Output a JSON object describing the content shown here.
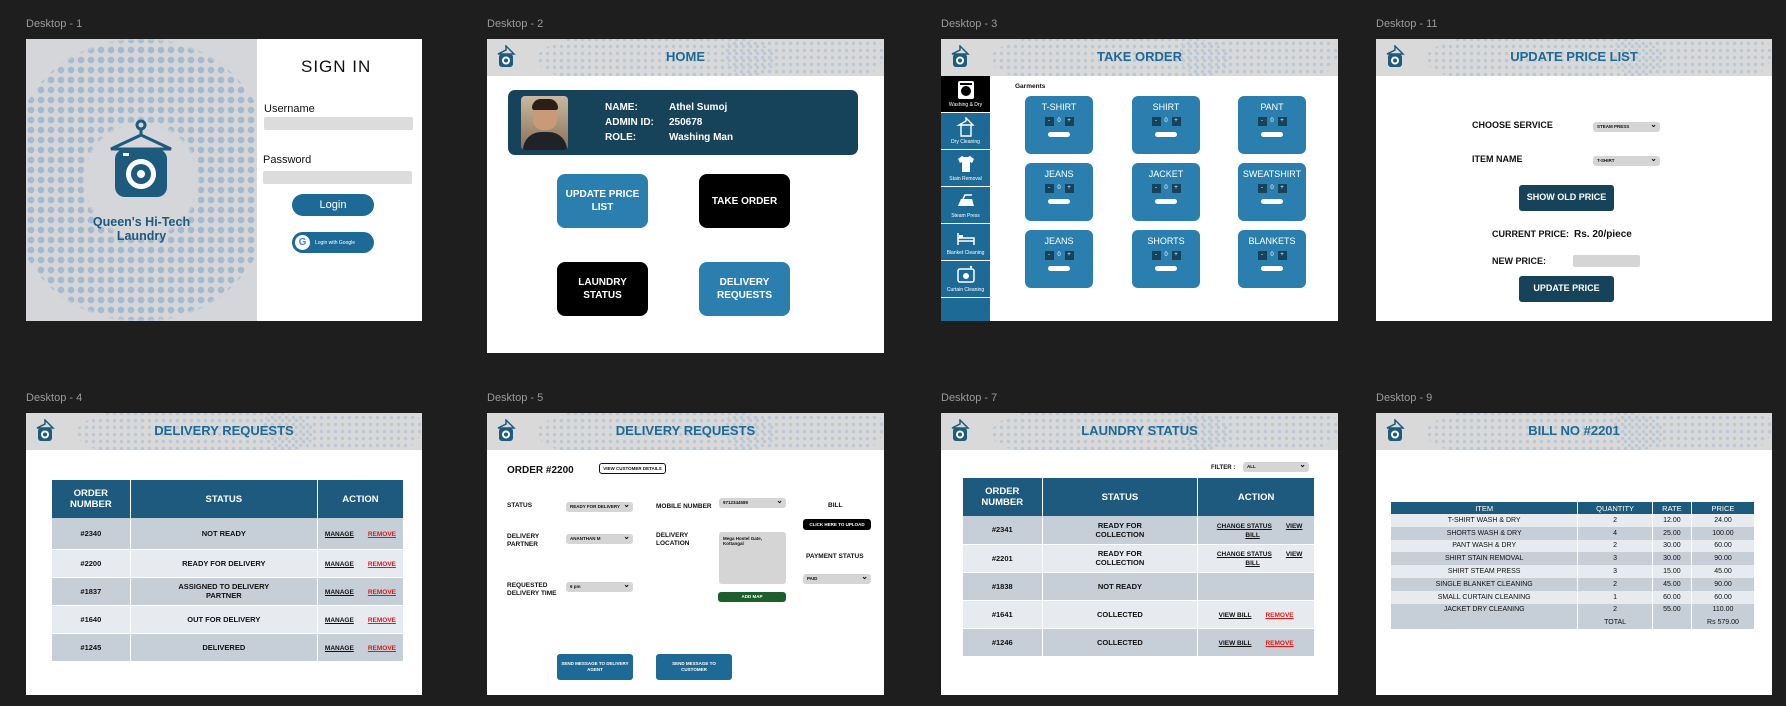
{
  "frames": {
    "d1": "Desktop - 1",
    "d2": "Desktop - 2",
    "d3": "Desktop - 3",
    "d11": "Desktop - 11",
    "d4": "Desktop - 4",
    "d5": "Desktop - 5",
    "d7": "Desktop - 7",
    "d9": "Desktop - 9"
  },
  "signin": {
    "brand": "Queen's Hi-Tech Laundry",
    "title": "SIGN IN",
    "username_label": "Username",
    "password_label": "Password",
    "login": "Login",
    "google": "Login with Google"
  },
  "home": {
    "title": "HOME",
    "name_label": "NAME:",
    "name": "Athel Sumoj",
    "id_label": "ADMIN ID:",
    "id": "250678",
    "role_label": "ROLE:",
    "role": "Washing Man",
    "btn_update": "UPDATE PRICE LIST",
    "btn_take": "TAKE ORDER",
    "btn_status": "LAUNDRY STATUS",
    "btn_delivery": "DELIVERY REQUESTS"
  },
  "take_order": {
    "title": "TAKE ORDER",
    "section": "Garments",
    "sidebar": [
      "Washing & Dry",
      "Dry Cleaning",
      "Stain Removal",
      "Steam Press",
      "Blanket Cleaning",
      "Curtain Cleaning"
    ],
    "garments": [
      "T-SHIRT",
      "SHIRT",
      "PANT",
      "JEANS",
      "JACKET",
      "SWEATSHIRT",
      "JEANS",
      "SHORTS",
      "BLANKETS"
    ],
    "qty": "0"
  },
  "update_price": {
    "title": "UPDATE PRICE LIST",
    "service_label": "CHOOSE SERVICE",
    "service_value": "STEAM PRESS",
    "item_label": "ITEM NAME",
    "item_value": "T-SHIRT",
    "show_old": "SHOW OLD PRICE",
    "current_label": "CURRENT PRICE:",
    "current_value": "Rs. 20/piece",
    "new_label": "NEW PRICE:",
    "update_btn": "UPDATE PRICE"
  },
  "delivery_requests": {
    "title": "DELIVERY REQUESTS",
    "headers": [
      "ORDER NUMBER",
      "STATUS",
      "ACTION"
    ],
    "manage": "MANAGE",
    "remove": "REMOVE",
    "rows": [
      {
        "order": "#2340",
        "status": "NOT READY"
      },
      {
        "order": "#2200",
        "status": "READY FOR DELIVERY"
      },
      {
        "order": "#1837",
        "status": "ASSIGNED TO DELIVERY PARTNER"
      },
      {
        "order": "#1640",
        "status": "OUT FOR DELIVERY"
      },
      {
        "order": "#1245",
        "status": "DELIVERED"
      }
    ]
  },
  "order_detail": {
    "title": "DELIVERY REQUESTS",
    "order": "ORDER #2200",
    "view_customer": "VIEW CUSTOMER DETAILS",
    "status_label": "STATUS",
    "status_value": "READY FOR DELIVERY",
    "partner_label": "DELIVERY PARTNER",
    "partner_value": "ANANTHAN M",
    "time_label": "REQUESTED DELIVERY TIME",
    "time_value": "6 pm",
    "mobile_label": "MOBILE NUMBER",
    "mobile_value": "9712344589",
    "location_label": "DELIVERY LOCATION",
    "location_value": "Mega Hostel Gate, Kottangal",
    "add_map": "ADD MAP",
    "bill_label": "BILL",
    "upload": "CLICK HERE TO UPLOAD",
    "payment_label": "PAYMENT STATUS",
    "payment_value": "PAID",
    "msg_agent": "SEND MESSAGE TO DELIVERY AGENT",
    "msg_customer": "SEND MESSAGE TO CUSTOMER"
  },
  "laundry_status": {
    "title": "LAUNDRY STATUS",
    "filter_label": "FILTER :",
    "filter_value": "ALL",
    "headers": [
      "ORDER NUMBER",
      "STATUS",
      "ACTION"
    ],
    "change": "CHANGE STATUS",
    "view": "VIEW BILL",
    "remove": "REMOVE",
    "rows": [
      {
        "order": "#2341",
        "status": "READY FOR COLLECTION"
      },
      {
        "order": "#2201",
        "status": "READY FOR COLLECTION"
      },
      {
        "order": "#1838",
        "status": "NOT READY"
      },
      {
        "order": "#1641",
        "status": "COLLECTED"
      },
      {
        "order": "#1246",
        "status": "COLLECTED"
      }
    ]
  },
  "bill": {
    "title": "BILL NO #2201",
    "headers": [
      "ITEM",
      "QUANTITY",
      "RATE",
      "PRICE"
    ],
    "rows": [
      [
        "T-SHIRT WASH & DRY",
        "2",
        "12.00",
        "24.00"
      ],
      [
        "SHORTS WASH & DRY",
        "4",
        "25.00",
        "100.00"
      ],
      [
        "PANT WASH & DRY",
        "2",
        "30.00",
        "60.00"
      ],
      [
        "SHIRT STAIN REMOVAL",
        "3",
        "30.00",
        "90.00"
      ],
      [
        "SHIRT STEAM PRESS",
        "3",
        "15.00",
        "45.00"
      ],
      [
        "SINGLE BLANKET CLEANING",
        "2",
        "45.00",
        "90.00"
      ],
      [
        "SMALL CURTAIN CLEANING",
        "1",
        "60.00",
        "60.00"
      ],
      [
        "JACKET DRY CLEANING",
        "2",
        "55.00",
        "110.00"
      ]
    ],
    "total_label": "TOTAL",
    "total": "Rs 579.00"
  }
}
